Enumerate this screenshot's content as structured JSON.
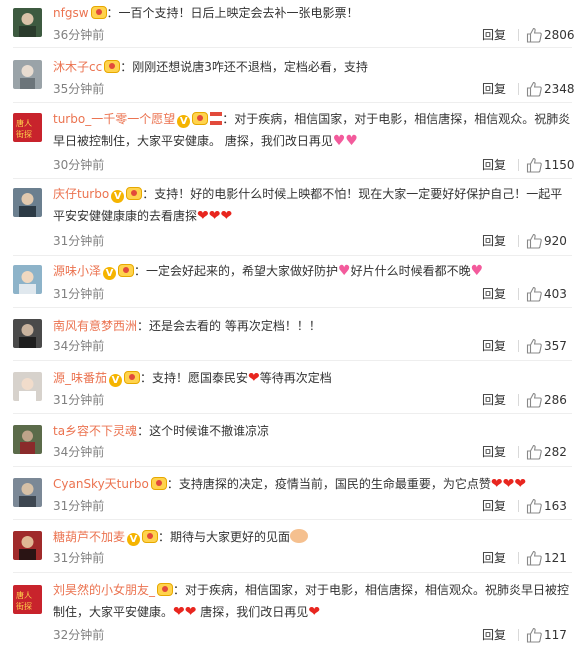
{
  "actions": {
    "reply_label": "回复"
  },
  "comments": [
    {
      "username": "nfgsw",
      "badges": [
        "fan-badge-icon"
      ],
      "text": "一百个支持！日后上映定会去补一张电影票！",
      "emojis": [],
      "time": "36分钟前",
      "likes": "2806",
      "avatar_color": "#3d5a40"
    },
    {
      "username": "沐木子cc",
      "badges": [
        "fan-badge-icon"
      ],
      "text": "刚刚还想说唐3咋还不退档，定档必看，支持",
      "emojis": [],
      "time": "35分钟前",
      "likes": "2348",
      "avatar_color": "#9aa3a8"
    },
    {
      "username": "turbo_一千零一个愿望",
      "badges": [
        "verified-badge-icon",
        "fan-badge-icon",
        "hourglass-icon"
      ],
      "text": "对于疾病，相信国家，对于电影，相信唐探，相信观众。祝肺炎早日被控制住，大家平安健康。 唐探，我们改日再见",
      "emojis": [
        "pink-heart-icon",
        "pink-heart-icon"
      ],
      "time": "30分钟前",
      "likes": "1150",
      "avatar_color": "#c8232c"
    },
    {
      "username": "庆仔turbo",
      "badges": [
        "verified-badge-icon",
        "fan-badge-icon"
      ],
      "text": "支持！好的电影什么时候上映都不怕！现在大家一定要好好保护自己！一起平平安安健健康康的去看唐探",
      "emojis": [
        "red-heart-icon",
        "red-heart-icon",
        "red-heart-icon"
      ],
      "time": "31分钟前",
      "likes": "920",
      "avatar_color": "#6b7f8f"
    },
    {
      "username": "源味小泽",
      "badges": [
        "verified-badge-icon",
        "fan-badge-icon"
      ],
      "text": "一定会好起来的，希望大家做好防护",
      "text2": "好片什么时候看都不晚",
      "emojis": [
        "pink-heart-icon"
      ],
      "emojis2": [
        "pink-heart-icon"
      ],
      "time": "31分钟前",
      "likes": "403",
      "avatar_color": "#8db3c9"
    },
    {
      "username": "南风有意梦西洲",
      "badges": [],
      "text": "还是会去看的 等再次定档！！！",
      "emojis": [],
      "time": "34分钟前",
      "likes": "357",
      "avatar_color": "#4a4a4a"
    },
    {
      "username": "源_味番茄",
      "badges": [
        "verified-badge-icon",
        "fan-badge-icon"
      ],
      "text": "支持！愿国泰民安",
      "text2": "等待再次定档",
      "emojis": [
        "red-heart-icon"
      ],
      "time": "31分钟前",
      "likes": "286",
      "avatar_color": "#d7d2cc"
    },
    {
      "username": "ta乡容不下灵魂",
      "badges": [],
      "text": "这个时候谁不撤谁凉凉",
      "emojis": [],
      "time": "34分钟前",
      "likes": "282",
      "avatar_color": "#5b6b4a"
    },
    {
      "username": "CyanSky天turbo",
      "badges": [
        "fan-badge-icon"
      ],
      "text": "支持唐探的决定，疫情当前，国民的生命最重要，为它点赞",
      "emojis": [
        "red-heart-icon",
        "red-heart-icon",
        "red-heart-icon"
      ],
      "time": "31分钟前",
      "likes": "163",
      "avatar_color": "#7b8896"
    },
    {
      "username": "糖葫芦不加麦",
      "badges": [
        "verified-badge-icon",
        "fan-badge-icon"
      ],
      "text": "期待与大家更好的见面",
      "emojis": [
        "folded-hands-icon"
      ],
      "time": "31分钟前",
      "likes": "121",
      "avatar_color": "#a02a2a"
    },
    {
      "username": "刘昊然的小女朋友_",
      "badges": [
        "fan-badge-icon"
      ],
      "text": "对于疾病，相信国家，对于电影，相信唐探，相信观众。祝肺炎早日被控制住，大家平安健康。",
      "text2": " 唐探，我们改日再见",
      "emojis": [
        "red-heart-icon",
        "red-heart-icon"
      ],
      "emojis2": [
        "red-heart-icon"
      ],
      "time": "32分钟前",
      "likes": "117",
      "avatar_color": "#c8232c"
    }
  ]
}
